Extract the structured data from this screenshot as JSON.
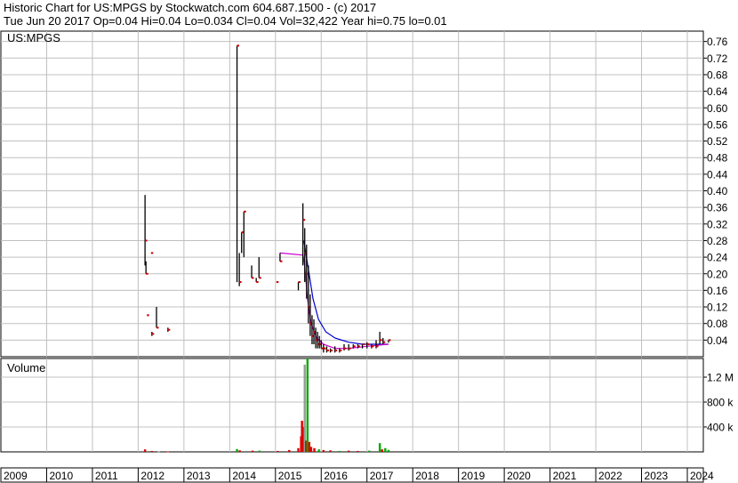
{
  "header": {
    "line1": "Historic Chart for US:MPGS by Stockwatch.com 604.687.1500 - (c) 2017",
    "line2": "Tue Jun 20 2017  Op=0.04  Hi=0.04  Lo=0.034  Cl=0.04  Vol=32,422  Year hi=0.75  lo=0.01"
  },
  "chart_data": [
    {
      "type": "ohlc",
      "title": "US:MPGS",
      "y_ticks": [
        "0.76",
        "0.72",
        "0.68",
        "0.64",
        "0.60",
        "0.56",
        "0.52",
        "0.48",
        "0.44",
        "0.40",
        "0.36",
        "0.32",
        "0.28",
        "0.24",
        "0.20",
        "0.16",
        "0.12",
        "0.08",
        "0.04"
      ],
      "ylim": [
        0,
        0.785
      ],
      "x_ticks": [
        "2009",
        "2010",
        "2011",
        "2012",
        "2013",
        "2014",
        "2015",
        "2016",
        "2017",
        "2018",
        "2019",
        "2020",
        "2021",
        "2022",
        "2023",
        "2024"
      ],
      "xlim": [
        2009.0,
        2024.35
      ],
      "grid": true,
      "colors": {
        "bar": "#000000",
        "close": "#cc0000",
        "ma_short": "#cc00cc",
        "ma_long": "#0000cc"
      },
      "bars": [
        {
          "t": 2012.15,
          "h": 0.39,
          "l": 0.22,
          "c": 0.28
        },
        {
          "t": 2012.17,
          "h": 0.23,
          "l": 0.2,
          "c": 0.2
        },
        {
          "t": 2012.19,
          "h": 0.1,
          "l": 0.1,
          "c": 0.1
        },
        {
          "t": 2012.28,
          "h": 0.25,
          "l": 0.25,
          "c": 0.25
        },
        {
          "t": 2012.3,
          "h": 0.06,
          "l": 0.05,
          "c": 0.055
        },
        {
          "t": 2012.4,
          "h": 0.12,
          "l": 0.07,
          "c": 0.07
        },
        {
          "t": 2012.65,
          "h": 0.07,
          "l": 0.06,
          "c": 0.065
        },
        {
          "t": 2014.16,
          "h": 0.75,
          "l": 0.18,
          "c": 0.75
        },
        {
          "t": 2014.21,
          "h": 0.25,
          "l": 0.17,
          "c": 0.18
        },
        {
          "t": 2014.26,
          "h": 0.3,
          "l": 0.25,
          "c": 0.3
        },
        {
          "t": 2014.31,
          "h": 0.35,
          "l": 0.24,
          "c": 0.35
        },
        {
          "t": 2014.48,
          "h": 0.22,
          "l": 0.19,
          "c": 0.19
        },
        {
          "t": 2014.58,
          "h": 0.19,
          "l": 0.18,
          "c": 0.18
        },
        {
          "t": 2014.64,
          "h": 0.24,
          "l": 0.19,
          "c": 0.19
        },
        {
          "t": 2015.02,
          "h": 0.18,
          "l": 0.18,
          "c": 0.18
        },
        {
          "t": 2015.1,
          "h": 0.25,
          "l": 0.23,
          "c": 0.23
        },
        {
          "t": 2015.5,
          "h": 0.18,
          "l": 0.16,
          "c": 0.18
        },
        {
          "t": 2015.6,
          "h": 0.37,
          "l": 0.22,
          "c": 0.33
        },
        {
          "t": 2015.64,
          "h": 0.31,
          "l": 0.18,
          "c": 0.25
        },
        {
          "t": 2015.68,
          "h": 0.27,
          "l": 0.14,
          "c": 0.2
        },
        {
          "t": 2015.72,
          "h": 0.22,
          "l": 0.08,
          "c": 0.12
        },
        {
          "t": 2015.76,
          "h": 0.15,
          "l": 0.05,
          "c": 0.08
        },
        {
          "t": 2015.8,
          "h": 0.1,
          "l": 0.03,
          "c": 0.05
        },
        {
          "t": 2015.84,
          "h": 0.09,
          "l": 0.03,
          "c": 0.06
        },
        {
          "t": 2015.88,
          "h": 0.07,
          "l": 0.02,
          "c": 0.04
        },
        {
          "t": 2015.92,
          "h": 0.06,
          "l": 0.02,
          "c": 0.03
        },
        {
          "t": 2015.96,
          "h": 0.05,
          "l": 0.02,
          "c": 0.03
        },
        {
          "t": 2016.0,
          "h": 0.04,
          "l": 0.02,
          "c": 0.02
        },
        {
          "t": 2016.05,
          "h": 0.03,
          "l": 0.01,
          "c": 0.02
        },
        {
          "t": 2016.12,
          "h": 0.025,
          "l": 0.01,
          "c": 0.015
        },
        {
          "t": 2016.2,
          "h": 0.02,
          "l": 0.01,
          "c": 0.015
        },
        {
          "t": 2016.3,
          "h": 0.025,
          "l": 0.01,
          "c": 0.015
        },
        {
          "t": 2016.4,
          "h": 0.02,
          "l": 0.01,
          "c": 0.015
        },
        {
          "t": 2016.5,
          "h": 0.03,
          "l": 0.015,
          "c": 0.02
        },
        {
          "t": 2016.6,
          "h": 0.03,
          "l": 0.015,
          "c": 0.02
        },
        {
          "t": 2016.7,
          "h": 0.03,
          "l": 0.02,
          "c": 0.025
        },
        {
          "t": 2016.8,
          "h": 0.03,
          "l": 0.02,
          "c": 0.025
        },
        {
          "t": 2016.9,
          "h": 0.03,
          "l": 0.02,
          "c": 0.03
        },
        {
          "t": 2017.0,
          "h": 0.035,
          "l": 0.02,
          "c": 0.03
        },
        {
          "t": 2017.1,
          "h": 0.03,
          "l": 0.02,
          "c": 0.025
        },
        {
          "t": 2017.2,
          "h": 0.04,
          "l": 0.02,
          "c": 0.025
        },
        {
          "t": 2017.28,
          "h": 0.06,
          "l": 0.03,
          "c": 0.04
        },
        {
          "t": 2017.35,
          "h": 0.045,
          "l": 0.03,
          "c": 0.035
        },
        {
          "t": 2017.47,
          "h": 0.04,
          "l": 0.034,
          "c": 0.04
        }
      ],
      "ma_short": [
        {
          "t": 2015.1,
          "v": 0.25
        },
        {
          "t": 2015.6,
          "v": 0.245
        },
        {
          "t": 2015.64,
          "v": 0.22
        },
        {
          "t": 2015.7,
          "v": 0.14
        },
        {
          "t": 2015.78,
          "v": 0.08
        },
        {
          "t": 2015.9,
          "v": 0.045
        },
        {
          "t": 2016.05,
          "v": 0.03
        },
        {
          "t": 2016.3,
          "v": 0.02
        },
        {
          "t": 2016.6,
          "v": 0.02
        },
        {
          "t": 2017.0,
          "v": 0.025
        },
        {
          "t": 2017.47,
          "v": 0.03
        }
      ],
      "ma_long": [
        {
          "t": 2015.62,
          "v": 0.28
        },
        {
          "t": 2015.72,
          "v": 0.21
        },
        {
          "t": 2015.82,
          "v": 0.14
        },
        {
          "t": 2015.94,
          "v": 0.09
        },
        {
          "t": 2016.1,
          "v": 0.06
        },
        {
          "t": 2016.3,
          "v": 0.045
        },
        {
          "t": 2016.6,
          "v": 0.035
        },
        {
          "t": 2016.9,
          "v": 0.03
        },
        {
          "t": 2017.2,
          "v": 0.03
        },
        {
          "t": 2017.47,
          "v": 0.03
        }
      ]
    },
    {
      "type": "bar",
      "title": "Volume",
      "y_ticks": [
        "1.2 M",
        "800 k",
        "400 k"
      ],
      "ylim": [
        0,
        1500000
      ],
      "grid": true,
      "colors": {
        "up": "#00aa00",
        "down": "#dd0000",
        "flat": "#999999"
      },
      "bars": [
        {
          "t": 2012.15,
          "v": 40000,
          "dir": "down"
        },
        {
          "t": 2012.3,
          "v": 15000,
          "dir": "down"
        },
        {
          "t": 2012.45,
          "v": 10000,
          "dir": "flat"
        },
        {
          "t": 2012.65,
          "v": 8000,
          "dir": "down"
        },
        {
          "t": 2014.16,
          "v": 45000,
          "dir": "up"
        },
        {
          "t": 2014.22,
          "v": 25000,
          "dir": "down"
        },
        {
          "t": 2014.5,
          "v": 20000,
          "dir": "down"
        },
        {
          "t": 2014.65,
          "v": 20000,
          "dir": "up"
        },
        {
          "t": 2015.05,
          "v": 15000,
          "dir": "down"
        },
        {
          "t": 2015.3,
          "v": 30000,
          "dir": "down"
        },
        {
          "t": 2015.5,
          "v": 60000,
          "dir": "down"
        },
        {
          "t": 2015.56,
          "v": 250000,
          "dir": "down"
        },
        {
          "t": 2015.58,
          "v": 500000,
          "dir": "down"
        },
        {
          "t": 2015.61,
          "v": 400000,
          "dir": "down"
        },
        {
          "t": 2015.64,
          "v": 1400000,
          "dir": "flat"
        },
        {
          "t": 2015.67,
          "v": 180000,
          "dir": "down"
        },
        {
          "t": 2015.7,
          "v": 1500000,
          "dir": "up"
        },
        {
          "t": 2015.74,
          "v": 160000,
          "dir": "down"
        },
        {
          "t": 2015.78,
          "v": 80000,
          "dir": "down"
        },
        {
          "t": 2015.85,
          "v": 60000,
          "dir": "down"
        },
        {
          "t": 2015.95,
          "v": 40000,
          "dir": "up"
        },
        {
          "t": 2016.05,
          "v": 30000,
          "dir": "down"
        },
        {
          "t": 2016.2,
          "v": 25000,
          "dir": "down"
        },
        {
          "t": 2016.4,
          "v": 15000,
          "dir": "up"
        },
        {
          "t": 2016.6,
          "v": 20000,
          "dir": "down"
        },
        {
          "t": 2016.8,
          "v": 15000,
          "dir": "down"
        },
        {
          "t": 2017.05,
          "v": 20000,
          "dir": "up"
        },
        {
          "t": 2017.28,
          "v": 140000,
          "dir": "up"
        },
        {
          "t": 2017.33,
          "v": 40000,
          "dir": "down"
        },
        {
          "t": 2017.4,
          "v": 60000,
          "dir": "up"
        },
        {
          "t": 2017.47,
          "v": 32422,
          "dir": "up"
        }
      ]
    }
  ]
}
